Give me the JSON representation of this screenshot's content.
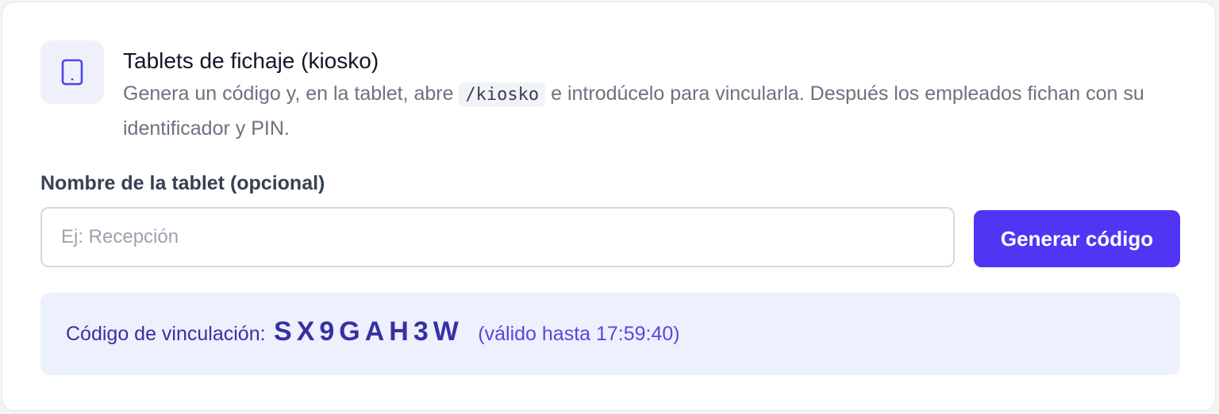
{
  "header": {
    "icon": "tablet-icon",
    "title": "Tablets de fichaje (kiosko)",
    "description_before": "Genera un código y, en la tablet, abre",
    "description_code": "/kiosko",
    "description_after": "e introdúcelo para vincularla. Después los empleados fichan con su identificador y PIN."
  },
  "form": {
    "label": "Nombre de la tablet (opcional)",
    "input_value": "",
    "input_placeholder": "Ej: Recepción",
    "button_label": "Generar código"
  },
  "result": {
    "label": "Código de vinculación:",
    "code": "SX9GAH3W",
    "validity": "(válido hasta 17:59:40)"
  },
  "colors": {
    "accent": "#5035f5",
    "result_background": "#edf0fd",
    "result_text": "#3730a3",
    "icon_color": "#4f46e5"
  }
}
